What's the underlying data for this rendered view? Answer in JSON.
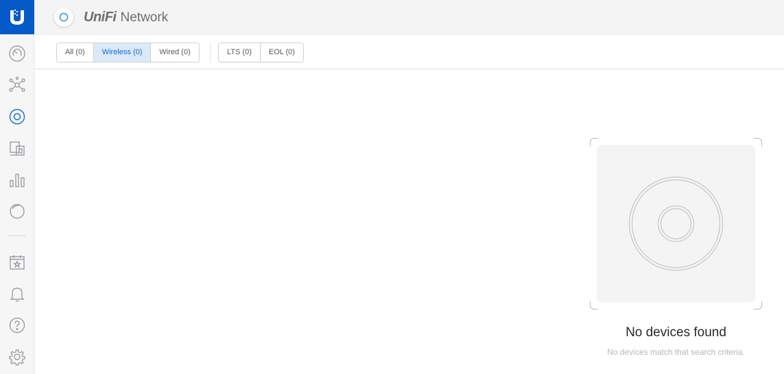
{
  "header": {
    "logo": "UniFi",
    "app_name": "Network"
  },
  "sidebar": {
    "items": [
      {
        "name": "dashboard-icon"
      },
      {
        "name": "topology-icon"
      },
      {
        "name": "devices-icon",
        "active": true
      },
      {
        "name": "clients-icon"
      },
      {
        "name": "statistics-icon"
      },
      {
        "name": "insights-icon"
      },
      {
        "name": "events-icon"
      },
      {
        "name": "alerts-icon"
      },
      {
        "name": "help-icon"
      },
      {
        "name": "settings-icon"
      }
    ]
  },
  "filters": {
    "type": [
      {
        "label": "All (0)"
      },
      {
        "label": "Wireless (0)",
        "active": true
      },
      {
        "label": "Wired (0)"
      }
    ],
    "release": [
      {
        "label": "LTS (0)"
      },
      {
        "label": "EOL (0)"
      }
    ]
  },
  "empty_state": {
    "title": "No devices found",
    "subtitle": "No devices match that search criteria."
  },
  "colors": {
    "brand": "#0559c9",
    "active_tab_bg": "#dde9f8",
    "active_tab_text": "#0b6bd6",
    "active_nav": "#0b6bd6"
  }
}
